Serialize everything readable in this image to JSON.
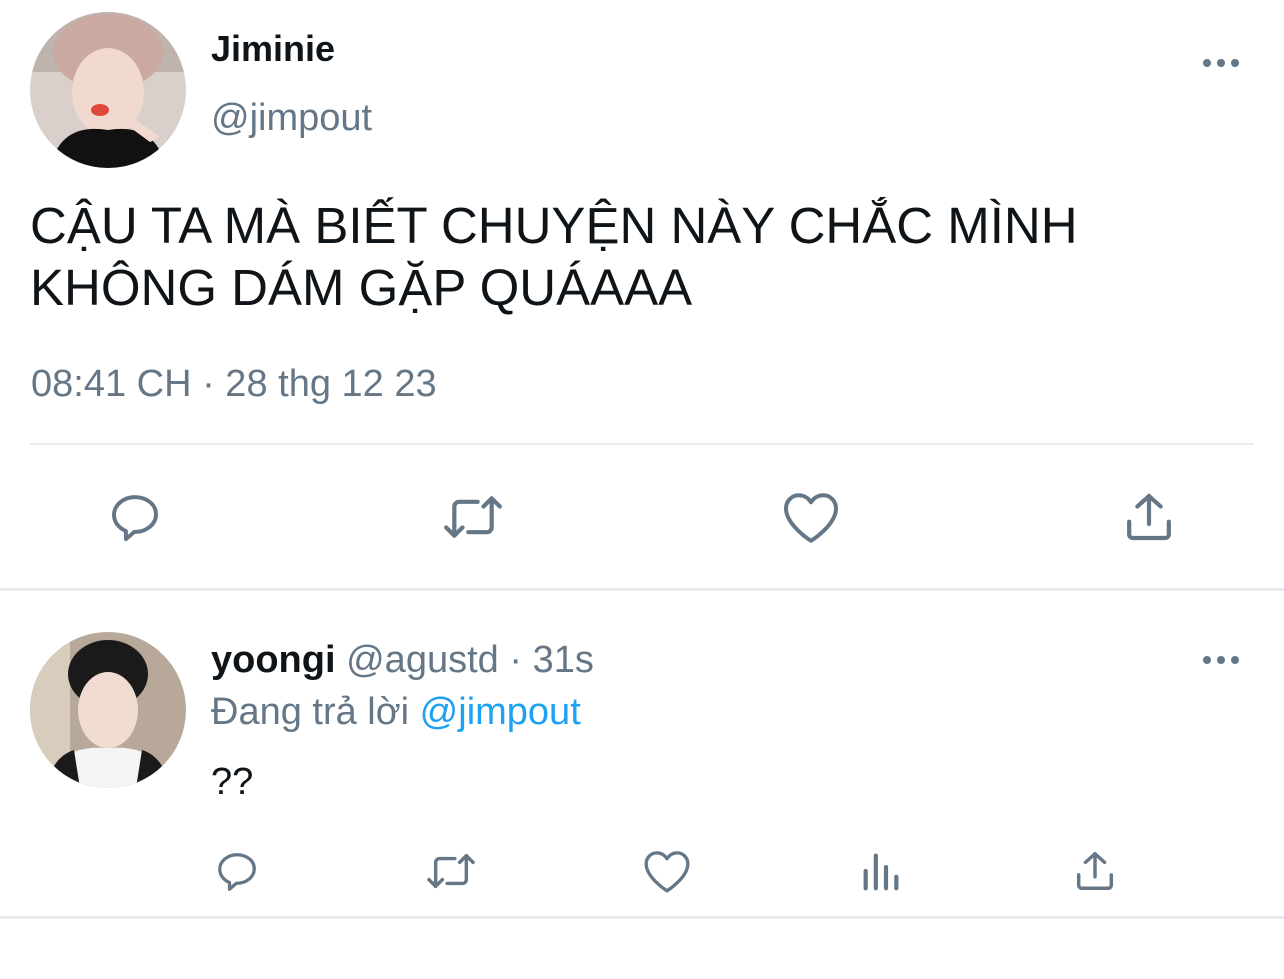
{
  "main_tweet": {
    "display_name": "Jiminie",
    "handle": "@jimpout",
    "text_line1": "CẬU TA MÀ BIẾT CHUYỆN NÀY CHẮC MÌNH",
    "text_line2": "KHÔNG DÁM GẶP QUÁAAA",
    "timestamp": "08:41 CH · 28 thg 12 23",
    "actions": [
      "reply-icon",
      "retweet-icon",
      "like-icon",
      "share-icon"
    ]
  },
  "reply_tweet": {
    "display_name": "yoongi",
    "handle": "@agustd",
    "separator": "·",
    "time": "31s",
    "replying_prefix": "Đang trả lời",
    "replying_to": "@jimpout",
    "text": "??",
    "actions": [
      "reply-icon",
      "retweet-icon",
      "like-icon",
      "analytics-icon",
      "share-icon"
    ]
  },
  "colors": {
    "text": "#0f1419",
    "secondary": "#657786",
    "link": "#1da1f2",
    "divider": "#e6ecf0"
  }
}
